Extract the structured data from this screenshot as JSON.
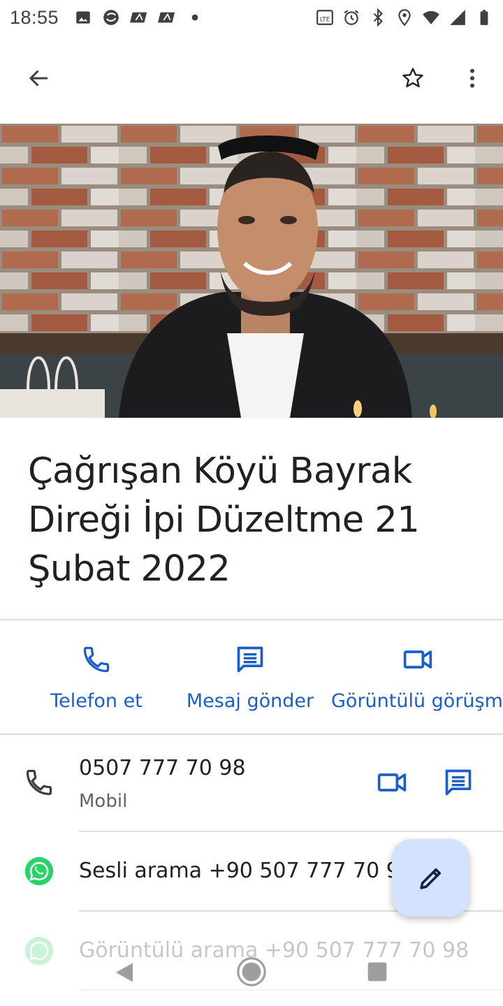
{
  "status_bar": {
    "time": "18:55",
    "left_icons": [
      "image-icon",
      "turkcell-icon",
      "voice-icon",
      "voice-icon",
      "dot-icon"
    ],
    "right_icons": [
      "volte-icon",
      "alarm-icon",
      "bluetooth-icon",
      "location-icon",
      "wifi-icon",
      "signal-icon",
      "battery-icon"
    ]
  },
  "app_bar": {
    "icons": [
      "back-arrow-icon",
      "star-outline-icon",
      "more-vert-icon"
    ]
  },
  "contact": {
    "name": "Çağrışan Köyü Bayrak Direği İpi Düzeltme 21 Şubat 2022"
  },
  "actions": [
    {
      "label": "Telefon et",
      "icon": "phone-icon"
    },
    {
      "label": "Mesaj gönder",
      "icon": "message-icon"
    },
    {
      "label": "Görüntülü görüşme",
      "icon": "videocam-icon"
    }
  ],
  "phone_entry": {
    "number": "0507 777 70 98",
    "type": "Mobil"
  },
  "whatsapp": {
    "voice": "Sesli arama +90 507 777 70 98",
    "video": "Görüntülü arama +90 507 777 70 98"
  },
  "colors": {
    "accent": "#1a5fc7",
    "fab_bg": "#d3e3fd",
    "whatsapp": "#25d366",
    "divider": "#dadce0"
  }
}
